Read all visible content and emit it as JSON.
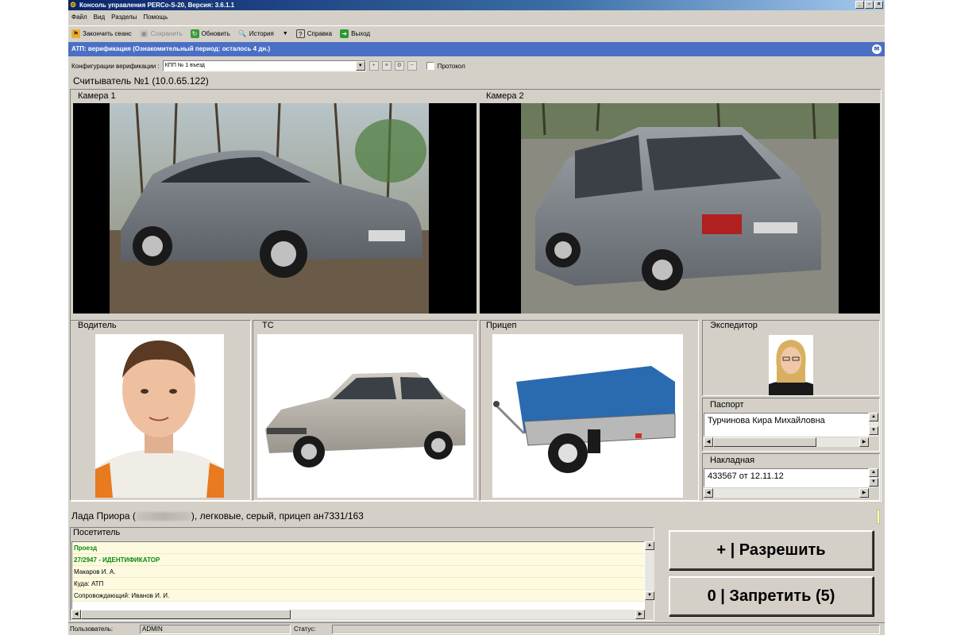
{
  "window": {
    "title": "Консоль управления PERCo-S-20, Версия: 3.6.1.1",
    "controls": [
      "_",
      "▫",
      "×"
    ]
  },
  "menu": [
    "Файл",
    "Вид",
    "Разделы",
    "Помощь"
  ],
  "toolbar": {
    "end_session": "Закончить сеанс",
    "save": "Сохранить",
    "refresh": "Обновить",
    "history": "История",
    "help": "Справка",
    "exit": "Выход"
  },
  "infobar": {
    "text": "АТП: верификация (Ознакомительный период: осталось 4 дн.)"
  },
  "config": {
    "label": "Конфигурации верификации :",
    "value": "КПП № 1 въезд",
    "protocol_label": "Протокол",
    "protocol_checked": false
  },
  "reader": {
    "title": "Считыватель №1 (10.0.65.122)"
  },
  "cameras": [
    {
      "label": "Камера 1"
    },
    {
      "label": "Камера 2"
    }
  ],
  "panels": {
    "driver": "Водитель",
    "vehicle": "ТС",
    "trailer": "Прицеп",
    "forwarder": "Экспедитор",
    "passport_label": "Паспорт",
    "passport_value": "Турчинова Кира Михайловна",
    "invoice_label": "Накладная",
    "invoice_value": "433567 от 12.11.12"
  },
  "vehicle_info": {
    "model": "Лада Приора (",
    "rest": "), легковые, серый, прицеп ан7331/163"
  },
  "visitor": {
    "title": "Посетитель",
    "rows": [
      {
        "text": "Проезд",
        "highlight": true
      },
      {
        "text": "27/2947 - ИДЕНТИФИКАТОР",
        "highlight": true
      },
      {
        "text": "Макаров И. А.",
        "highlight": false
      },
      {
        "text": "Куда: АТП",
        "highlight": false
      },
      {
        "text": "Сопровождающий: Иванов И. И.",
        "highlight": false
      }
    ]
  },
  "actions": {
    "allow": "+ | Разрешить",
    "deny": "0 | Запретить (5)"
  },
  "status": {
    "user_label": "Пользователь:",
    "user_value": "ADMIN",
    "status_label": "Статус:",
    "status_value": ""
  },
  "colors": {
    "window_bg": "#d4d0c8",
    "infobar": "#4a6fc4",
    "highlight_text": "#0a8a0a"
  }
}
